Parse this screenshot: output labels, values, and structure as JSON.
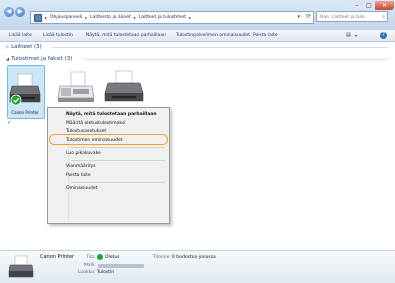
{
  "address": {
    "crumbs": [
      "Ohjauspaneeli",
      "Laitteisto ja äänet",
      "Laitteet ja tulostimet"
    ],
    "refresh_icon": "refresh-icon"
  },
  "search": {
    "placeholder": "Hae: Laitteet ja tulo..."
  },
  "toolbar": {
    "items": [
      "Lisää laite",
      "Lisää tulostin",
      "Näytä, mitä tulostetaan parhaillaan",
      "Tulostinpalvelimen ominaisuudet",
      "Poista laite"
    ]
  },
  "groups": {
    "devices": "Laitteet (3)",
    "printers": "Tulostimet ja faksit (3)"
  },
  "printer": {
    "name": "Canon Printer"
  },
  "context_menu": {
    "items": [
      "Näytä, mitä tulostetaan parhaillaan",
      "Määritä oletustulostimeksi",
      "Tulostusasetukset",
      "Tulostimen ominaisuudet",
      "Luo pikakuvake",
      "Vianmääritys",
      "Poista laite",
      "Ominaisuudet"
    ],
    "highlighted": "Tulostimen ominaisuudet"
  },
  "details": {
    "name": "Canon Printer",
    "tila_label": "Tila:",
    "tila_value": "Oletus",
    "malli_label": "Malli:",
    "luokka_label": "Luokka:",
    "luokka_value": "Tulostin",
    "tilanne_label": "Tilanne:",
    "tilanne_value": "0 tiedostoa jonossa"
  }
}
